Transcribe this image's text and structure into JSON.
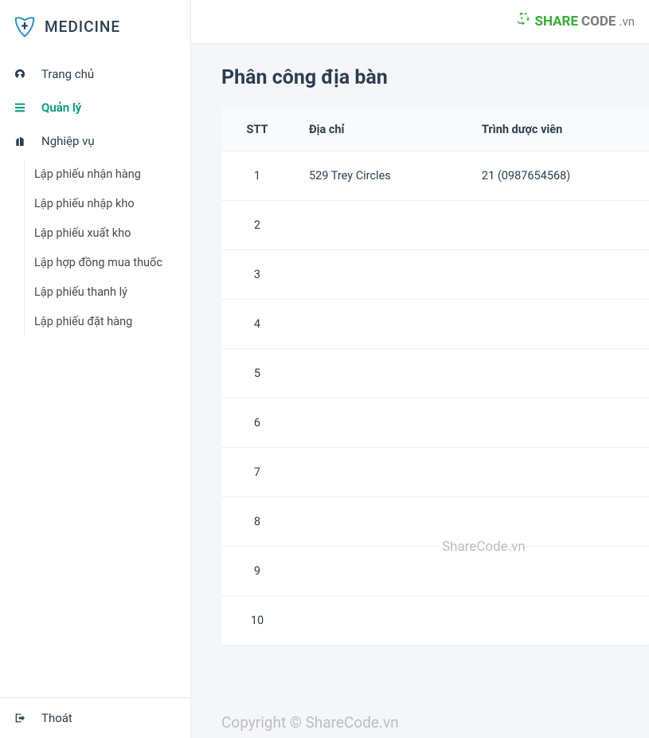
{
  "brand": {
    "title": "MEDICINE"
  },
  "nav": {
    "home": "Trang chủ",
    "manage": "Quản lý",
    "business": "Nghiệp vụ"
  },
  "submenu": [
    "Lập phiếu nhận hàng",
    "Lập phiếu nhập kho",
    "Lập phiếu xuất kho",
    "Lập hợp đồng mua thuốc",
    "Lập phiếu thanh lý",
    "Lập phiếu đặt hàng"
  ],
  "logout": "Thoát",
  "header": {
    "logo_share": "SHARE",
    "logo_code": "CODE",
    "logo_vn": ".vn"
  },
  "page": {
    "title": "Phân công địa bàn"
  },
  "table": {
    "columns": {
      "stt": "STT",
      "address": "Địa chỉ",
      "rep": "Trình dược viên"
    },
    "rows": [
      {
        "stt": "1",
        "address": "529 Trey Circles",
        "rep": "21 (0987654568)"
      },
      {
        "stt": "2",
        "address": "",
        "rep": ""
      },
      {
        "stt": "3",
        "address": "",
        "rep": ""
      },
      {
        "stt": "4",
        "address": "",
        "rep": ""
      },
      {
        "stt": "5",
        "address": "",
        "rep": ""
      },
      {
        "stt": "6",
        "address": "",
        "rep": ""
      },
      {
        "stt": "7",
        "address": "",
        "rep": ""
      },
      {
        "stt": "8",
        "address": "",
        "rep": ""
      },
      {
        "stt": "9",
        "address": "",
        "rep": ""
      },
      {
        "stt": "10",
        "address": "",
        "rep": ""
      }
    ]
  },
  "watermark": {
    "w1": "ShareCode.vn",
    "w2": "Copyright © ShareCode.vn"
  }
}
